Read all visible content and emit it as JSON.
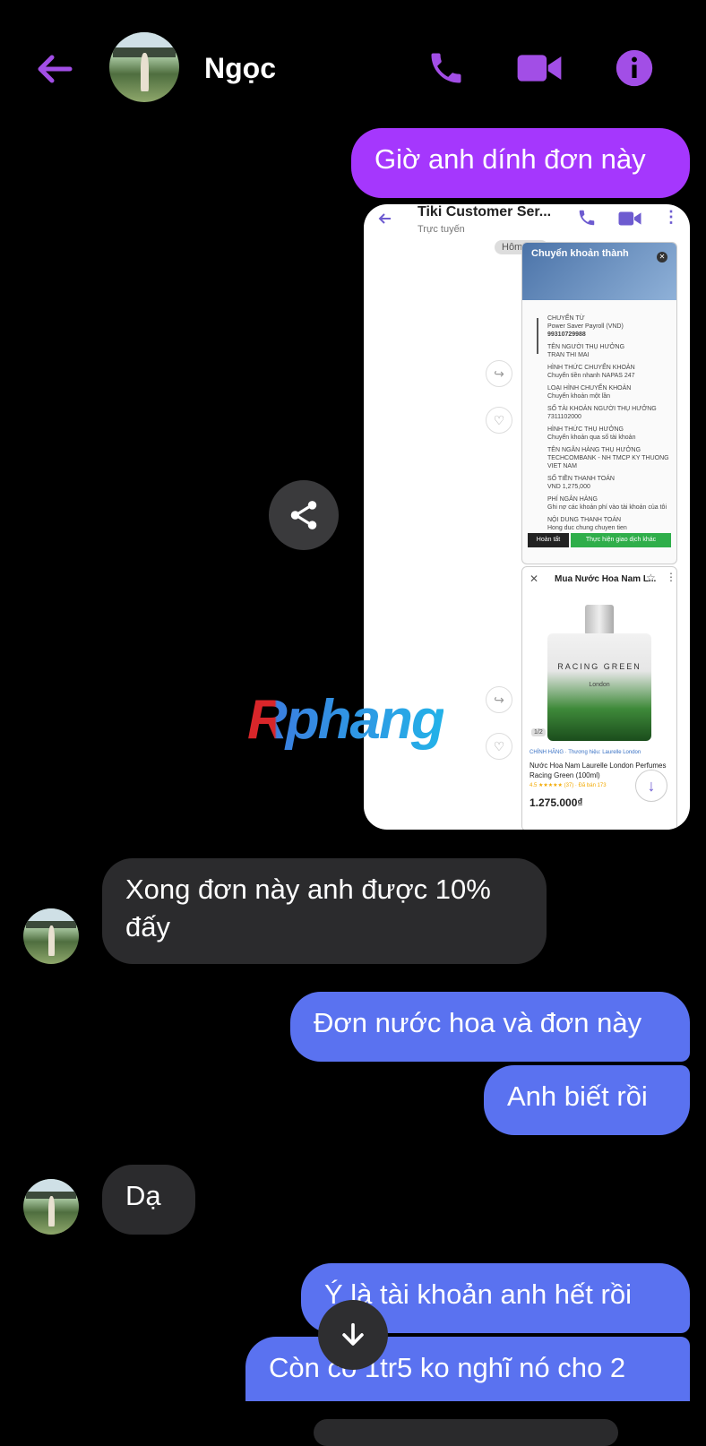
{
  "header": {
    "contact_name": "Ngọc",
    "icons": [
      "back-arrow-icon",
      "phone-icon",
      "video-icon",
      "info-icon"
    ]
  },
  "messages": {
    "m1": "Giờ anh dính đơn này",
    "m2": "Xong đơn này anh được 10% đấy",
    "m3": "Đơn nước hoa và đơn này",
    "m4": "Anh biết rồi",
    "m5": "Dạ",
    "m6": "Ý là tài khoản anh hết rồi",
    "m7": "Còn có 1tr5 ko nghĩ nó cho 2"
  },
  "shot": {
    "title": "Tiki Customer Ser...",
    "status": "Trực tuyến",
    "chip": "Hôm nay",
    "transfer_title": "Chuyển khoản thành",
    "rows": [
      "CHUYỂN TỪ",
      "Power Saver Payroll (VND)",
      "99310729988",
      "TÊN NGƯỜI THỤ HƯỞNG",
      "TRAN THI MAI",
      "HÌNH THỨC CHUYỂN KHOẢN",
      "Chuyển tiền nhanh NAPAS 247",
      "LOẠI HÌNH CHUYỂN KHOẢN",
      "Chuyển khoản một lần",
      "SỐ TÀI KHOẢN NGƯỜI THỤ HƯỞNG",
      "7311102000",
      "HÌNH THỨC THỤ HƯỞNG",
      "Chuyển khoản qua số tài khoản",
      "TÊN NGÂN HÀNG THỤ HƯỞNG",
      "TECHCOMBANK - NH TMCP KY THUONG",
      "VIET NAM",
      "SỐ TIỀN THANH TOÁN",
      "VND 1,275,000",
      "PHÍ NGÂN HÀNG",
      "Ghi nợ các khoản phí vào tài khoản của tôi",
      "NỘI DUNG THANH TOÁN",
      "Hong duc chung chuyen tien"
    ],
    "btn_left": "Hoàn tất",
    "btn_right": "Thực hiện giao dịch khác",
    "product_header": "Mua Nước Hoa Nam L...",
    "bottle_label": "RACING GREEN",
    "bottle_sub": "London",
    "img_count": "1/2",
    "brand_line": "CHÍNH HÃNG · Thương hiệu: Laurelle London",
    "product_name": "Nước Hoa Nam Laurelle London Perfumes Racing Green (100ml)",
    "rating": "4.5 ★★★★★ (37) · Đã bán 173",
    "price": "1.275.000₫"
  },
  "watermark": "Rphang",
  "colors": {
    "accent_purple": "#a537fd",
    "accent_blue": "#5a72f0",
    "incoming_bg": "#2b2b2d"
  }
}
